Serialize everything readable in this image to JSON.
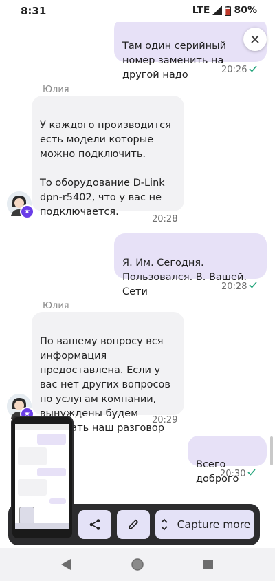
{
  "status": {
    "time": "8:31",
    "network": "LTE",
    "battery": "80%"
  },
  "messages": [
    {
      "id": "m1",
      "direction": "out",
      "text": "Там один серийный номер заменить на другой надо",
      "time": "20:26",
      "read": true
    },
    {
      "id": "m2",
      "direction": "in",
      "sender": "Юлия",
      "text": "У каждого производится есть модели которые можно подключить.\n\nТо оборудование D-Link dpn-r5402, что у вас не подключается.",
      "time": "20:28"
    },
    {
      "id": "m3",
      "direction": "out",
      "text": "Я. Им. Сегодня. Пользовался. В. Вашей. Сети",
      "time": "20:28",
      "read": true
    },
    {
      "id": "m4",
      "direction": "in",
      "sender": "Юлия",
      "text": "По вашему вопросу вся информация предоставлена. Если у вас нет других вопросов по услугам компании, вынуждены будем прервать наш разговор",
      "time": "20:29"
    },
    {
      "id": "m5",
      "direction": "out",
      "text": "Всего доброго",
      "time": "20:30",
      "read": true
    }
  ],
  "screenshot_toolbar": {
    "capture_more_label": "Capture more"
  },
  "icons": {
    "close": "close-icon",
    "share": "share-icon",
    "edit": "pencil-icon",
    "expand": "expand-vertical-icon",
    "check": "check-icon",
    "back": "back-triangle-icon",
    "home": "home-circle-icon",
    "recents": "recents-square-icon"
  },
  "colors": {
    "outgoing_bubble": "#e7e1f7",
    "incoming_bubble": "#f2f2f4",
    "check": "#22a37a",
    "badge": "#6a3de8",
    "toolbar": "#2c2c2e"
  }
}
